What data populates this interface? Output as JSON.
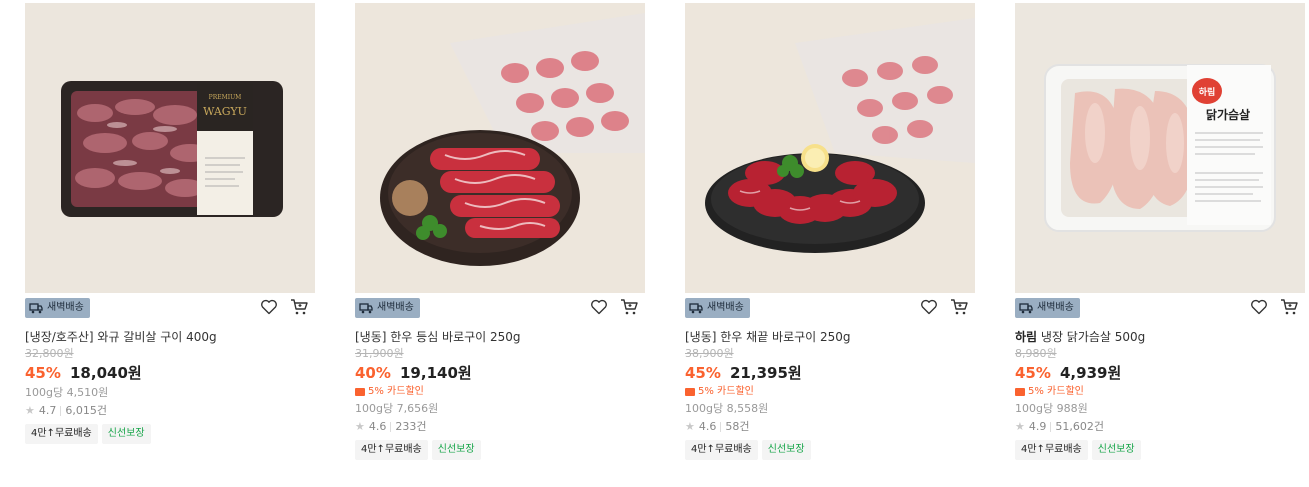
{
  "products": [
    {
      "badge": "새벽배송",
      "name_prefix": "",
      "name": "[냉장/호주산] 와규 갈비살 구이 400g",
      "original_price": "32,800원",
      "discount": "45%",
      "price": "18,040원",
      "coupon": "",
      "unit_price": "100g당 4,510원",
      "rating": "4.7",
      "reviews": "6,015건",
      "tags": [
        "4만↑무료배송",
        "신선보장"
      ]
    },
    {
      "badge": "새벽배송",
      "name_prefix": "",
      "name": "[냉동] 한우 등심 바로구이 250g",
      "original_price": "31,900원",
      "discount": "40%",
      "price": "19,140원",
      "coupon": "5% 카드할인",
      "unit_price": "100g당 7,656원",
      "rating": "4.6",
      "reviews": "233건",
      "tags": [
        "4만↑무료배송",
        "신선보장"
      ]
    },
    {
      "badge": "새벽배송",
      "name_prefix": "",
      "name": "[냉동] 한우 채끝 바로구이 250g",
      "original_price": "38,900원",
      "discount": "45%",
      "price": "21,395원",
      "coupon": "5% 카드할인",
      "unit_price": "100g당 8,558원",
      "rating": "4.6",
      "reviews": "58건",
      "tags": [
        "4만↑무료배송",
        "신선보장"
      ]
    },
    {
      "badge": "새벽배송",
      "name_prefix": "하림",
      "name": " 냉장 닭가슴살 500g",
      "original_price": "8,980원",
      "discount": "45%",
      "price": "4,939원",
      "coupon": "5% 카드할인",
      "unit_price": "100g당 988원",
      "rating": "4.9",
      "reviews": "51,602건",
      "tags": [
        "4만↑무료배송",
        "신선보장"
      ]
    }
  ],
  "icons": {
    "wishlist": "heart-icon",
    "cart": "cart-icon",
    "badge": "truck-icon",
    "coupon": "card-icon",
    "rating": "star-icon"
  },
  "images": {
    "p0_label": "WAGYU",
    "p0_ribbon": "PREMIUM",
    "p3_brand": "하림",
    "p3_label": "닭가슴살"
  },
  "colors": {
    "discount": "#fa622f",
    "badge_bg": "#9aaec2",
    "fresh_tag": "#18a54a"
  }
}
